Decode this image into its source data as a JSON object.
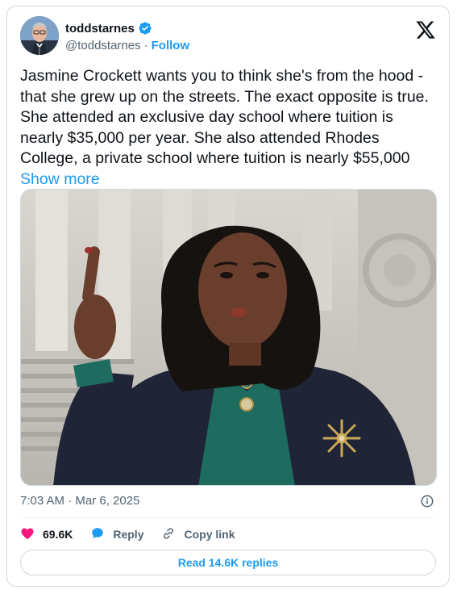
{
  "author": {
    "display_name": "toddstarnes",
    "handle": "@toddstarnes",
    "follow_label": "Follow",
    "separator": "·"
  },
  "tweet": {
    "text": "Jasmine Crockett wants you to think she's from the hood - that she grew up on the streets. The exact opposite is true. She attended an exclusive day school where tuition is nearly $35,000 per year. She also attended Rhodes College, a private school where tuition is nearly $55,000",
    "show_more_label": "Show more",
    "timestamp": "7:03 AM · Mar 6, 2025"
  },
  "actions": {
    "like_count": "69.6K",
    "reply_label": "Reply",
    "copy_link_label": "Copy link",
    "read_replies_label": "Read 14.6K replies"
  },
  "colors": {
    "accent": "#1d9bf0",
    "like": "#f91880",
    "muted": "#536471",
    "border": "#cfd9de"
  },
  "icons": {
    "verified": "verified-badge-icon",
    "x_logo": "x-logo-icon",
    "info": "info-icon",
    "like": "heart-icon",
    "reply": "speech-bubble-icon",
    "copy": "link-icon"
  }
}
